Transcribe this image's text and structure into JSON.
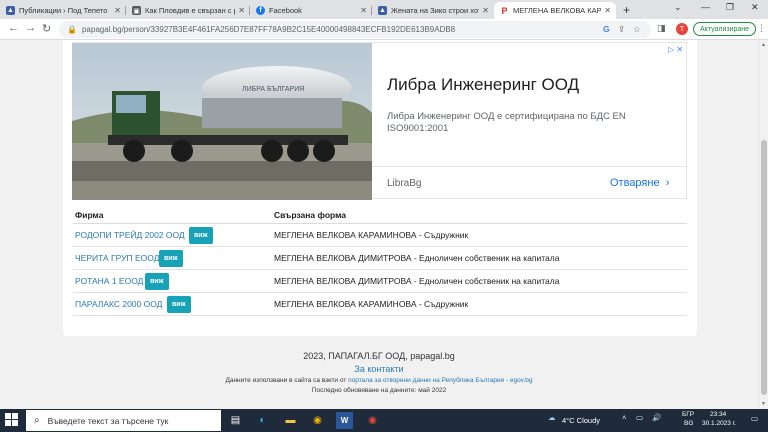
{
  "browser": {
    "tabs": [
      {
        "title": "Публикации › Под Тепето",
        "active": false,
        "fav": "triangle"
      },
      {
        "title": "Как Пловдив е свързан с ро",
        "active": false,
        "fav": "news"
      },
      {
        "title": "Facebook",
        "active": false,
        "fav": "facebook"
      },
      {
        "title": "Жената на Зико строи хоте",
        "active": false,
        "fav": "triangle"
      },
      {
        "title": "МЕГЛЕНА ВЕЛКОВА КАРАМ",
        "active": true,
        "fav": "papagal"
      }
    ],
    "url": "papagal.bg/person/33927B3E4F461FA256D7E87FF78A9B2C15E40000498843ECFB192DE613B9ADB8",
    "profile_letter": "Т",
    "update_label": "Актуализиране"
  },
  "ad": {
    "title": "Либра Инженеринг ООД",
    "description": "Либра Инженеринг ООД е сертифицирана по БДС EN ISO9001:2001",
    "brand": "LibraBg",
    "open_label": "Отваряне",
    "truck_text": "ЛИБРА БЪЛГАРИЯ"
  },
  "table": {
    "headers": [
      "Фирма",
      "Свързана форма"
    ],
    "view_label": "виж",
    "rows": [
      {
        "firm": "РОДОПИ ТРЕЙД 2002 ООД",
        "form": "МЕГЛЕНА ВЕЛКОВА КАРАМИНОВА - Съдружник"
      },
      {
        "firm": "ЧЕРИТА ГРУП ЕООД",
        "form": "МЕГЛЕНА ВЕЛКОВА ДИМИТРОВА - Едноличен собственик на капитала"
      },
      {
        "firm": "РОТАНА 1 ЕООД",
        "form": "МЕГЛЕНА ВЕЛКОВА ДИМИТРОВА - Едноличен собственик на капитала"
      },
      {
        "firm": "ПАРАЛАКС 2000 ООД",
        "form": "МЕГЛЕНА ВЕЛКОВА КАРАМИНОВА - Съдружник"
      }
    ]
  },
  "footer": {
    "copyright": "2023, ПАПАГАЛ.БГ ООД, papagal.bg",
    "contact": "За контакти",
    "data_prefix": "Данните използвани в сайта са взети от",
    "data_link": "портала за отворени данни на Република България - egov.bg",
    "updated": "Последно обновяване на данните: май 2022"
  },
  "taskbar": {
    "search_placeholder": "Въведете текст за търсене тук",
    "weather": "4°C  Cloudy",
    "lang": "БГР",
    "lang2": "BG",
    "time": "23:34",
    "date": "30.1.2023 г."
  },
  "colors": {
    "view_button": "#17a2b8",
    "link": "#2a7ab0",
    "ad_link": "#1a73e8"
  }
}
